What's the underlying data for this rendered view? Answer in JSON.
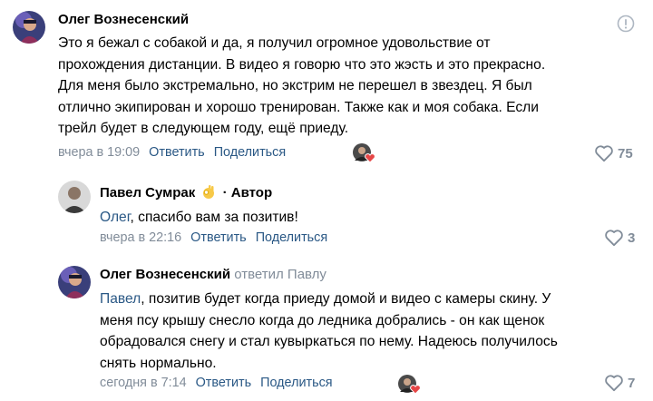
{
  "comments": [
    {
      "author": "Олег Вознесенский",
      "text_lines": [
        "Это я бежал с собакой и да, я получил огромное удовольствие от",
        "прохождения дистанции. В видео я говорю что это жэсть и это прекрасно.",
        "Для меня было экстремально, но экстрим не перешел в звездец. Я был",
        "отлично экипирован и хорошо тренирован. Также как и моя собака. Если",
        "трейл будет в следующем году, ещё приеду."
      ],
      "time": "вчера в 19:09",
      "reply_label": "Ответить",
      "share_label": "Поделиться",
      "likes": "75",
      "icons": {
        "report": "report-icon",
        "heart": "heart-icon"
      }
    },
    {
      "author": "Павел Сумрак",
      "badge": "Автор",
      "mention": "Олег",
      "text": ", спасибо вам за позитив!",
      "time": "вчера в 22:16",
      "reply_label": "Ответить",
      "share_label": "Поделиться",
      "likes": "3"
    },
    {
      "author": "Олег Вознесенский",
      "replied_to": "ответил Павлу",
      "mention": "Павел",
      "first_line_rest": ", позитив будет когда приеду домой и видео с камеры скину. У",
      "text_lines": [
        "меня псу крышу снесло когда до ледника добрались - он как щенок",
        "обрадовался снегу и стал кувыркаться по нему. Надеюсь получилось",
        "снять нормально."
      ],
      "time": "сегодня в 7:14",
      "reply_label": "Ответить",
      "share_label": "Поделиться",
      "likes": "7"
    }
  ],
  "colors": {
    "link": "#2a5885",
    "meta": "#818c99",
    "heart_red": "#e64646"
  }
}
